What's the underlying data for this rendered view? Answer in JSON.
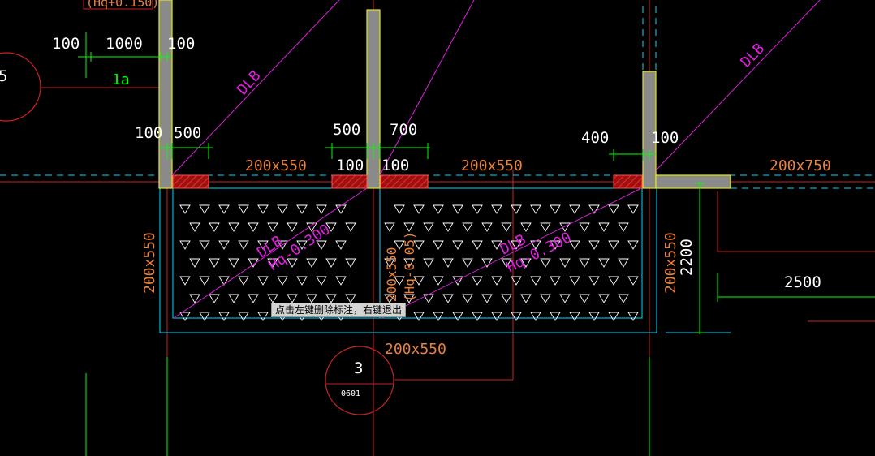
{
  "dims": {
    "d100_a": "100",
    "d1000": "1000",
    "d100_b": "100",
    "d100_c": "100",
    "d500_a": "500",
    "d500_b": "500",
    "d700": "700",
    "d400": "400",
    "d100_d": "100",
    "d100_e": "100",
    "d100_f": "100",
    "d2200": "2200",
    "d2500": "2500",
    "tag_1a": "1a"
  },
  "beams": {
    "top_left": "200x550",
    "top_mid": "200x550",
    "top_right": "200x750",
    "left_v": "200x550",
    "right_v": "200x550",
    "bottom": "200x550",
    "mid_v_a": "200x550",
    "mid_v_b": "(Hq-0.05)"
  },
  "slabs": {
    "dlb_1": "DLB",
    "dlb_2": "DLB",
    "dlb_3": "DLB",
    "dlb_4": "DLB",
    "hq_1": "Hq-0.300",
    "hq_2": "Hq-0.300"
  },
  "axis_bubbles": {
    "axis_3": "3",
    "axis_3_sub": "0601",
    "axis_5": "5",
    "top_tag": "(Hq+0.150)"
  },
  "status": {
    "tooltip": "点击左键删除标注，右键退出"
  },
  "colors": {
    "background": "#000000",
    "dim_text": "#ffffff",
    "dim_line": "#00ff00",
    "beam_text": "#e8823c",
    "slab_line": "#e020e0",
    "axis_red": "#cc2222",
    "cyan": "#00d8ff",
    "wall_fill": "#8a8a8a",
    "wall_edge": "#e8e800"
  }
}
